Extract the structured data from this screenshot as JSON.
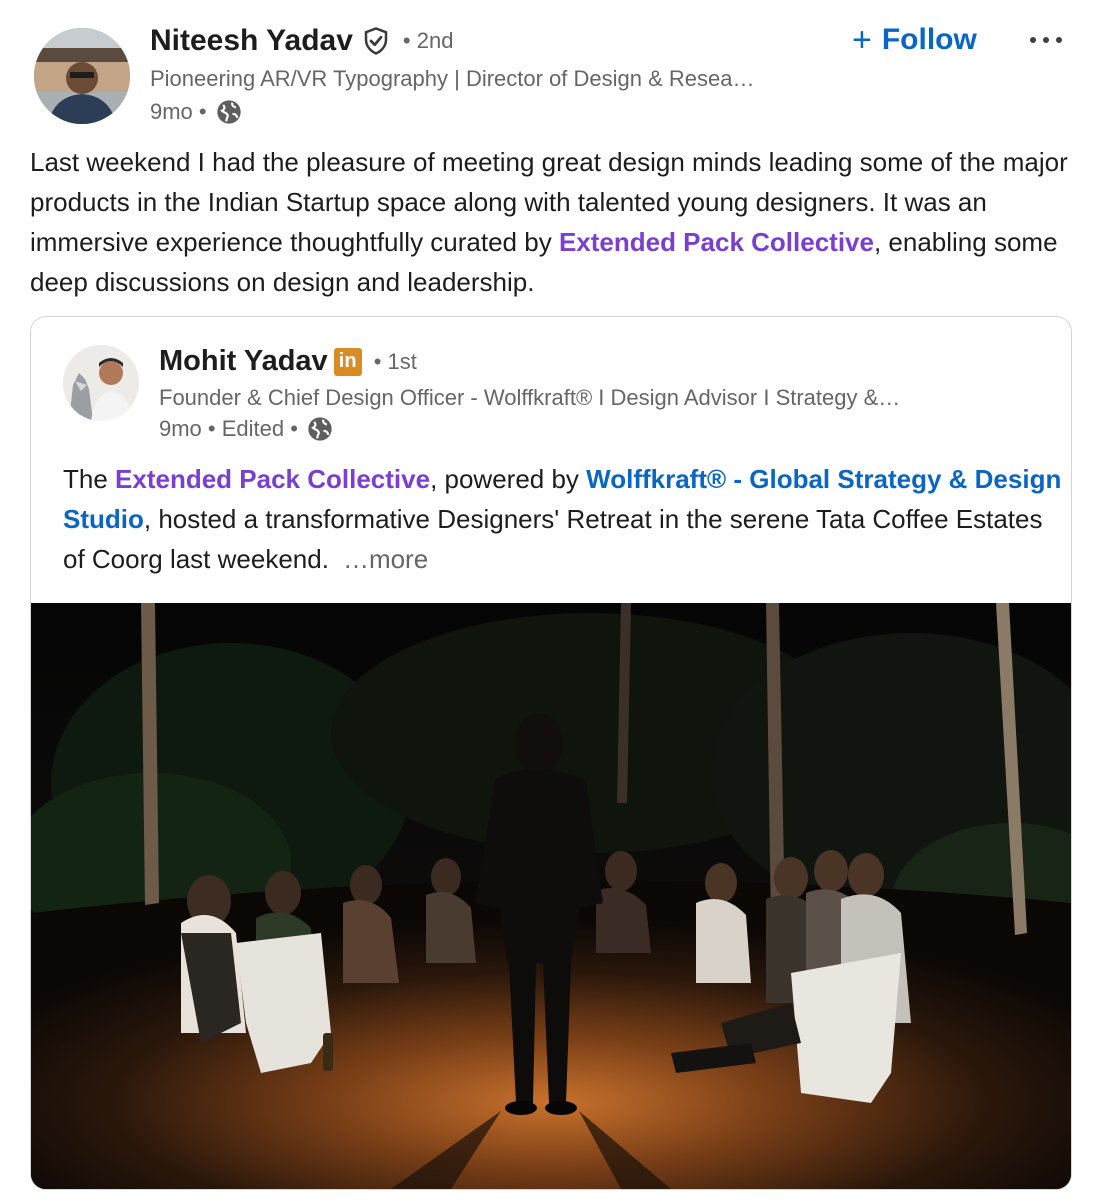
{
  "post": {
    "author": {
      "name": "Niteesh Yadav",
      "degree": "• 2nd",
      "headline": "Pioneering AR/VR Typography | Director of Design & Resea…",
      "time": "9mo •"
    },
    "follow_label": "Follow",
    "text_before": "Last weekend I had the pleasure of meeting great design minds leading some of the major products in the Indian Startup space along with talented young designers. It was an immersive experience thoughtfully curated by ",
    "text_link": "Extended Pack Collective",
    "text_after": ", enabling some deep discussions on design and leadership."
  },
  "shared": {
    "author": {
      "name": "Mohit Yadav",
      "degree": "• 1st",
      "headline": "Founder & Chief Design Officer - Wolffkraft® I Design Advisor I Strategy &…",
      "time": "9mo • Edited •"
    },
    "text_1": "The ",
    "link_1": "Extended Pack Collective",
    "text_2": ", powered by ",
    "link_2": "Wolffkraft® - Global Strategy & Design Studio",
    "text_3": ", hosted a transformative Designers' Retreat in the serene Tata Coffee Estates of Coorg last weekend.",
    "see_more": "…more"
  },
  "icons": {
    "verified": "verified-shield-icon",
    "globe": "globe-icon",
    "linkedin": "linkedin-icon",
    "more": "more-options-icon"
  },
  "colors": {
    "accent_blue": "#0a66c2",
    "mention_purple": "#7a3fd0",
    "muted_text": "#666666"
  }
}
